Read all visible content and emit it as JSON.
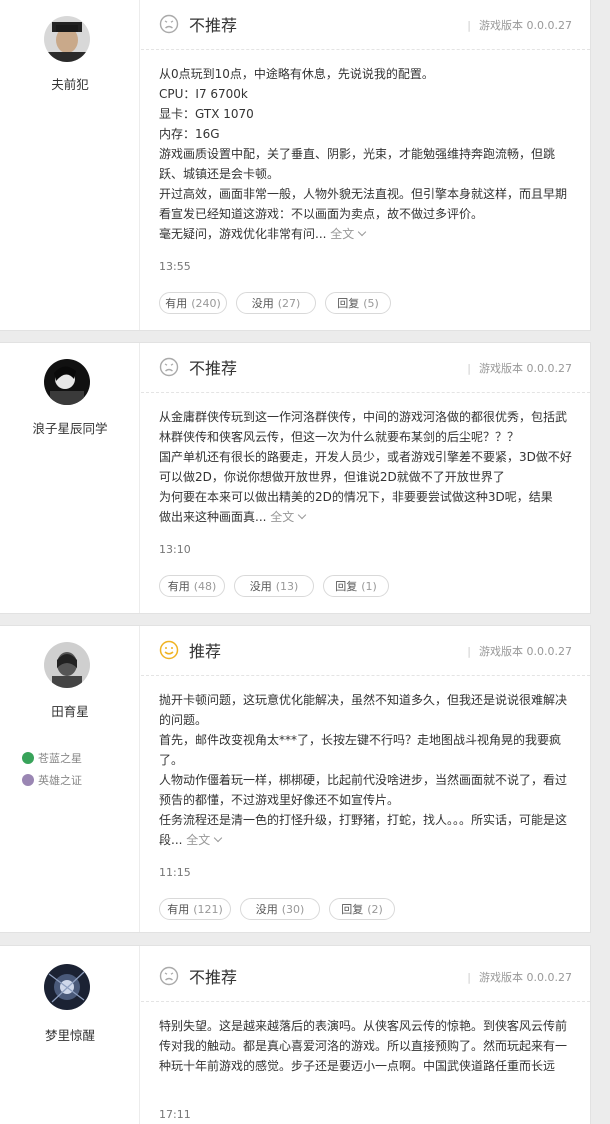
{
  "reviews": [
    {
      "username": "夫前犯",
      "verdict": "不推荐",
      "version": "游戏版本 0.0.0.27",
      "paragraphs": [
        "从0点玩到10点，中途略有休息，先说说我的配置。",
        "CPU：I7 6700k",
        "显卡：GTX 1070",
        "内存：16G",
        "游戏画质设置中配，关了垂直、阴影，光束，才能勉强维持奔跑流畅，但跳跃、城镇还是会卡顿。",
        "开过高效，画面非常一般，人物外貌无法直视。但引擎本身就这样，而且早期看宣发已经知道这游戏：不以画面为卖点，故不做过多评价。"
      ],
      "last_line": "毫无疑问，游戏优化非常有问...",
      "full_text": "全文",
      "time": "13:55",
      "useful_label": "有用",
      "useful_count": "(240)",
      "useless_label": "没用",
      "useless_count": "(27)",
      "reply_label": "回复",
      "reply_count": "(5)"
    },
    {
      "username": "浪子星辰同学",
      "verdict": "不推荐",
      "version": "游戏版本 0.0.0.27",
      "paragraphs": [
        "从金庸群侠传玩到这一作河洛群侠传，中间的游戏河洛做的都很优秀，包括武林群侠传和侠客风云传，但这一次为什么就要布某剑的后尘呢？？？",
        "国产单机还有很长的路要走，开发人员少，或者游戏引擎差不要紧，3D做不好可以做2D，你说你想做开放世界，但谁说2D就做不了开放世界了",
        "为何要在本来可以做出精美的2D的情况下，非要要尝试做这种3D呢，结果"
      ],
      "last_line": "做出来这种画面真...",
      "full_text": "全文",
      "time": "13:10",
      "useful_label": "有用",
      "useful_count": "(48)",
      "useless_label": "没用",
      "useless_count": "(13)",
      "reply_label": "回复",
      "reply_count": "(1)"
    },
    {
      "username": "田育星",
      "badges": [
        "苍蓝之星",
        "英雄之证"
      ],
      "verdict": "推荐",
      "version": "游戏版本 0.0.0.27",
      "paragraphs": [
        "抛开卡顿问题，这玩意优化能解决，虽然不知道多久，但我还是说说很难解决的问题。",
        "首先，邮件改变视角太***了，长按左键不行吗？走地图战斗视角晃的我要疯了。",
        "人物动作僵着玩一样，梆梆硬，比起前代没啥进步，当然画面就不说了，看过预告的都懂，不过游戏里好像还不如宣传片。"
      ],
      "last_line_prefix": "任务流程还是清一色的打怪升级，打野猪，打蛇，找人。。。所实话，可",
      "last_line": "能是这段...",
      "full_text": "全文",
      "time": "11:15",
      "useful_label": "有用",
      "useful_count": "(121)",
      "useless_label": "没用",
      "useless_count": "(30)",
      "reply_label": "回复",
      "reply_count": "(2)"
    },
    {
      "username": "梦里惊醒",
      "verdict": "不推荐",
      "version": "游戏版本 0.0.0.27",
      "paragraphs": [
        "特别失望。这是越来越落后的表演吗。从侠客风云传的惊艳。到侠客风云传前传对我的触动。都是真心喜爱河洛的游戏。所以直接预购了。然而玩起来有一种玩十年前游戏的感觉。步子还是要迈小一点啊。中国武侠道路任重而长远"
      ],
      "time": "17:11"
    }
  ]
}
